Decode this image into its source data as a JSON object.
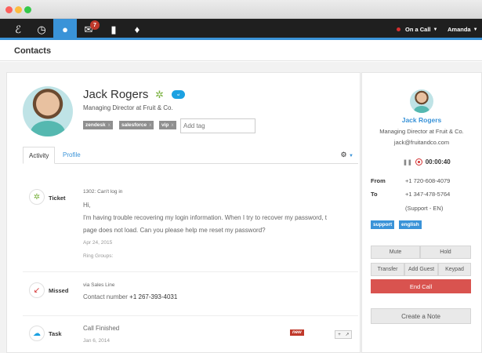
{
  "nav": {
    "badge_count": "7",
    "call_status": "On a Call",
    "user": "Amanda"
  },
  "page": {
    "title": "Contacts"
  },
  "contact": {
    "name": "Jack Rogers",
    "title": "Managing Director at Fruit & Co.",
    "tags": [
      "zendesk",
      "salesforce",
      "vip"
    ],
    "add_tag_placeholder": "Add tag"
  },
  "tabs": [
    {
      "label": "Activity",
      "active": true
    },
    {
      "label": "Profile",
      "active": false
    }
  ],
  "activities": [
    {
      "type": "Ticket",
      "icon": "zendesk-gear-icon",
      "subject": "1302: Can't log in",
      "greeting": "Hi,",
      "line1": "I'm having trouble recovering my login information. When I try to recover my password, t",
      "line2": "page does not load. Can you please help me reset my password?",
      "date": "Apr 24, 2015",
      "ring_groups": "Ring Groups:"
    },
    {
      "type": "Missed",
      "icon": "missed-call-icon",
      "via": "via Sales Line",
      "contact_label": "Contact number",
      "contact_number": "+1 267-393-4031"
    },
    {
      "type": "Task",
      "icon": "salesforce-cloud-icon",
      "subject": "Call Finished",
      "date": "Jan 6, 2014",
      "badge": "new"
    }
  ],
  "call": {
    "name": "Jack Rogers",
    "title": "Managing Director at Fruit & Co.",
    "email": "jack@fruitandco.com",
    "timer": "00:00:40",
    "from_label": "From",
    "from_number": "+1 720-608-4079",
    "to_label": "To",
    "to_number": "+1 347-478-5764",
    "to_detail": "(Support - EN)",
    "tags": [
      "support",
      "english"
    ],
    "buttons": {
      "mute": "Mute",
      "hold": "Hold",
      "transfer": "Transfer",
      "add_guest": "Add Guest",
      "keypad": "Keypad",
      "end_call": "End Call",
      "create_note": "Create a Note"
    }
  },
  "colors": {
    "accent": "#3a93d8",
    "danger": "#d9534f",
    "zendesk": "#7cb342",
    "salesforce": "#1ba1e2"
  }
}
